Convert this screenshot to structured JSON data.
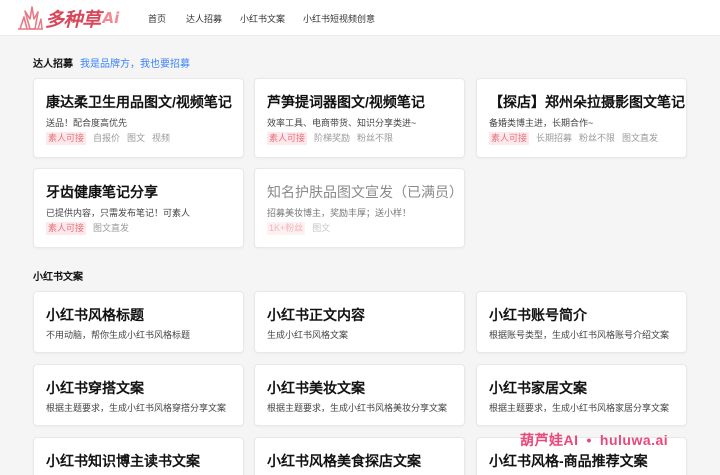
{
  "header": {
    "logo_text": "多种草",
    "logo_ai": "Ai",
    "nav": [
      {
        "label": "首页"
      },
      {
        "label": "达人招募"
      },
      {
        "label": "小红书文案"
      },
      {
        "label": "小红书短视频创意"
      }
    ]
  },
  "recruit_section": {
    "title": "达人招募",
    "link": "我是品牌方，我也要招募",
    "cards": [
      {
        "title": "康达柔卫生用品图文/视频笔记",
        "desc": "送品！配合度高优先",
        "tags": [
          "素人可接",
          "自报价",
          "图文",
          "视频"
        ]
      },
      {
        "title": "芦笋提词器图文/视频笔记",
        "desc": "效率工具、电商带货、知识分享类进~",
        "tags": [
          "素人可接",
          "阶梯奖励",
          "粉丝不限"
        ]
      },
      {
        "title": "【探店】郑州朵拉摄影图文笔记",
        "desc": "备婚类博主进，长期合作~",
        "tags": [
          "素人可接",
          "长期招募",
          "粉丝不限",
          "图文直发"
        ]
      },
      {
        "title": "牙齿健康笔记分享",
        "desc": "已提供内容，只需发布笔记！可素人",
        "tags": [
          "素人可接",
          "图文直发"
        ]
      },
      {
        "title": "知名护肤品图文宣发（已满员）",
        "desc": "招募美妆博主，奖励丰厚；送小样！",
        "tags": [
          "1K+粉丝",
          "图文"
        ]
      }
    ]
  },
  "copy_section": {
    "title": "小红书文案",
    "cards": [
      {
        "title": "小红书风格标题",
        "desc": "不用动脑，帮你生成小红书风格标题"
      },
      {
        "title": "小红书正文内容",
        "desc": "生成小红书风格文案"
      },
      {
        "title": "小红书账号简介",
        "desc": "根据账号类型，生成小红书风格账号介绍文案"
      },
      {
        "title": "小红书穿搭文案",
        "desc": "根据主题要求，生成小红书风格穿搭分享文案"
      },
      {
        "title": "小红书美妆文案",
        "desc": "根据主题要求，生成小红书风格美妆分享文案"
      },
      {
        "title": "小红书家居文案",
        "desc": "根据主题要求，生成小红书风格家居分享文案"
      },
      {
        "title": "小红书知识博主读书文案",
        "desc": ""
      },
      {
        "title": "小红书风格美食探店文案",
        "desc": ""
      },
      {
        "title": "小红书风格-商品推荐文案",
        "desc": ""
      }
    ]
  },
  "watermark": {
    "left": "葫芦娃AI",
    "dot": "•",
    "right": "huluwa.ai"
  },
  "colors": {
    "brand": "#d8485a",
    "link": "#3b82f6",
    "tag_highlight": "#e8747f",
    "watermark": "#e8487a"
  }
}
